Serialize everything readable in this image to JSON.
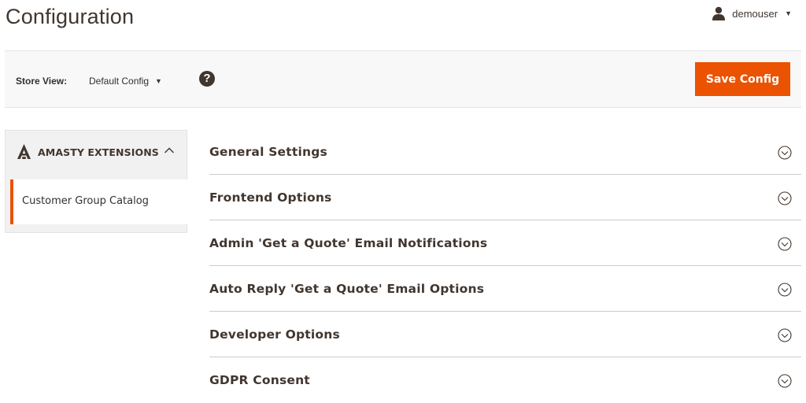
{
  "header": {
    "title": "Configuration",
    "user": {
      "name": "demouser",
      "icon": "user-icon",
      "menu_icon": "caret-down-icon"
    }
  },
  "toolbar": {
    "store_view_label": "Store View:",
    "store_view_value": "Default Config",
    "help_icon": "question-mark-icon",
    "help_glyph": "?",
    "save_label": "Save Config"
  },
  "sidebar": {
    "group": {
      "title": "AMASTY EXTENSIONS",
      "icon": "amasty-logo-icon",
      "expanded": true
    },
    "items": [
      {
        "label": "Customer Group Catalog",
        "active": true
      }
    ]
  },
  "sections": [
    {
      "title": "General Settings"
    },
    {
      "title": "Frontend Options"
    },
    {
      "title": "Admin 'Get a Quote' Email Notifications"
    },
    {
      "title": "Auto Reply 'Get a Quote' Email Options"
    },
    {
      "title": "Developer Options"
    },
    {
      "title": "GDPR Consent"
    }
  ],
  "colors": {
    "accent": "#eb5202",
    "text_dark": "#41362f",
    "toolbar_bg": "#f8f8f8",
    "sidebar_bg": "#f1f1f1"
  }
}
